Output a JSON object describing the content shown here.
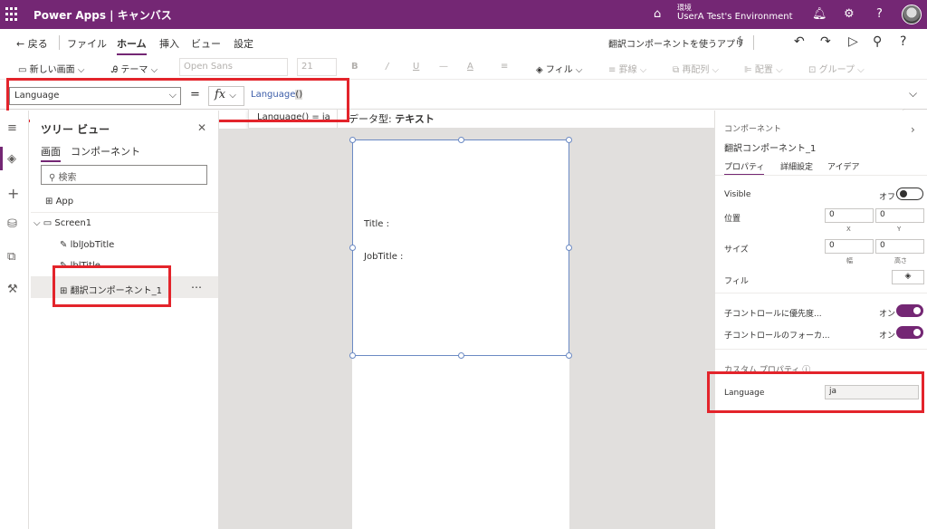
{
  "topbar": {
    "app_name": "Power Apps | キャンバス",
    "env_label": "環境",
    "env_name": "UserA Test's Environment",
    "accent": "#742774"
  },
  "commands": {
    "back": "戻る",
    "menus": [
      "ファイル",
      "ホーム",
      "挿入",
      "ビュー",
      "設定"
    ],
    "active_menu": "ホーム",
    "app_title": "翻訳コンポーネントを使うアプリ"
  },
  "ribbon": {
    "new_screen": "新しい画面",
    "theme": "テーマ",
    "font": "Open Sans",
    "font_size": "21",
    "fill": "フィル",
    "border": "罫線",
    "reorder": "再配列",
    "align": "配置",
    "group": "グループ"
  },
  "formula_bar": {
    "property": "Language",
    "equals": "=",
    "fx": "fx",
    "formula_name": "Language",
    "formula_parens": "()",
    "autocomplete_value": "Language()  =  ja",
    "data_type_label": "データ型:",
    "data_type_value": "テキスト"
  },
  "tree_view": {
    "title": "ツリー ビュー",
    "tabs": [
      "画面",
      "コンポーネント"
    ],
    "search_placeholder": "検索",
    "app_node": "App",
    "screen_node": "Screen1",
    "items": [
      "lblJobTitle",
      "lblTitle",
      "翻訳コンポーネント_1"
    ],
    "more": "⋯"
  },
  "canvas": {
    "title_label": "Title :",
    "jobtitle_label": "JobTitle :"
  },
  "properties": {
    "header": "コンポーネント",
    "component_name": "翻訳コンポーネント_1",
    "tabs": [
      "プロパティ",
      "詳細設定",
      "アイデア"
    ],
    "visible_label": "Visible",
    "visible_state": "オフ",
    "position_label": "位置",
    "position_x": "0",
    "position_y": "0",
    "x_label": "X",
    "y_label": "Y",
    "size_label": "サイズ",
    "size_w": "0",
    "size_h": "0",
    "w_label": "幅",
    "h_label": "高さ",
    "fill_label": "フィル",
    "child_priority_label": "子コントロールに優先度...",
    "child_priority_state": "オン",
    "child_focus_label": "子コントロールのフォーカ...",
    "child_focus_state": "オン",
    "custom_props_label": "カスタム プロパティ",
    "language_label": "Language",
    "language_value": "ja"
  }
}
